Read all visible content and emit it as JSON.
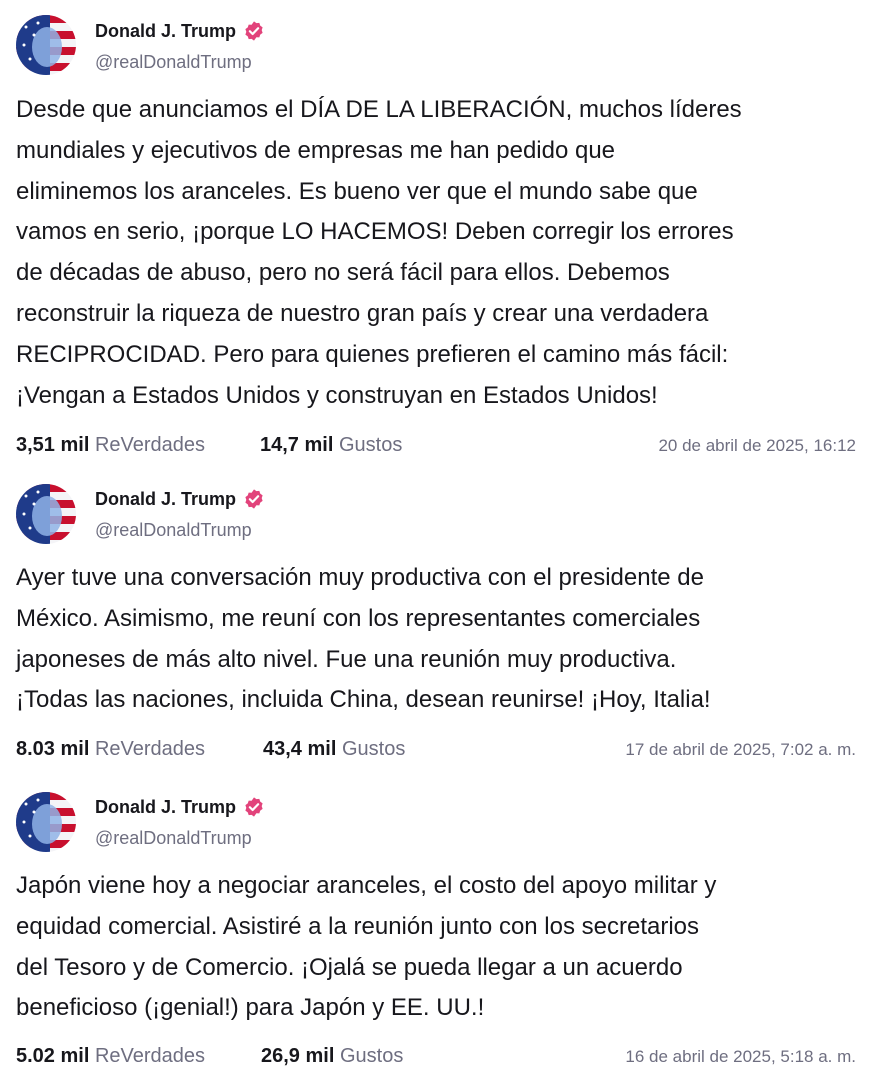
{
  "colors": {
    "text": "#17171c",
    "muted": "#6e6e80",
    "verified_badge": "#e2437b"
  },
  "posts": [
    {
      "author": {
        "name": "Donald J. Trump",
        "handle": "@realDonaldTrump",
        "verified_icon": "verified-badge-icon"
      },
      "text": "Desde que anunciamos el DÍA DE LA LIBERACIÓN, muchos líderes\nmundiales y ejecutivos de empresas me han pedido que\neliminemos los aranceles. Es bueno ver que el mundo sabe que\nvamos en serio, ¡porque LO HACEMOS! Deben corregir los errores\nde décadas de abuso, pero no será fácil para ellos. Debemos\nreconstruir la riqueza de nuestro gran país y crear una verdadera\nRECIPROCIDAD. Pero para quienes prefieren el camino más fácil:\n¡Vengan a Estados Unidos y construyan en Estados Unidos!",
      "reposts_count": "3,51 mil",
      "reposts_label": "ReVerdades",
      "likes_count": "14,7 mil",
      "likes_label": "Gustos",
      "date": "20 de abril de 2025, 16:12"
    },
    {
      "author": {
        "name": "Donald J. Trump",
        "handle": "@realDonaldTrump",
        "verified_icon": "verified-badge-icon"
      },
      "text": "Ayer tuve una conversación muy productiva con el presidente de\nMéxico. Asimismo, me reuní con los representantes comerciales\njaponeses de más alto nivel. Fue una reunión muy productiva.\n¡Todas las naciones, incluida China, desean reunirse! ¡Hoy, Italia!",
      "reposts_count": "8.03 mil",
      "reposts_label": "ReVerdades",
      "likes_count": "43,4 mil",
      "likes_label": "Gustos",
      "date": "17 de abril de 2025, 7:02 a. m."
    },
    {
      "author": {
        "name": "Donald J. Trump",
        "handle": "@realDonaldTrump",
        "verified_icon": "verified-badge-icon"
      },
      "text": "Japón viene hoy a negociar aranceles, el costo del apoyo militar y\nequidad comercial. Asistiré a la reunión junto con los secretarios\ndel Tesoro y de Comercio. ¡Ojalá se pueda llegar a un acuerdo\nbeneficioso (¡genial!) para Japón y EE. UU.!",
      "reposts_count": "5.02 mil",
      "reposts_label": "ReVerdades",
      "likes_count": "26,9 mil",
      "likes_label": "Gustos",
      "date": "16 de abril de 2025, 5:18 a. m."
    }
  ]
}
